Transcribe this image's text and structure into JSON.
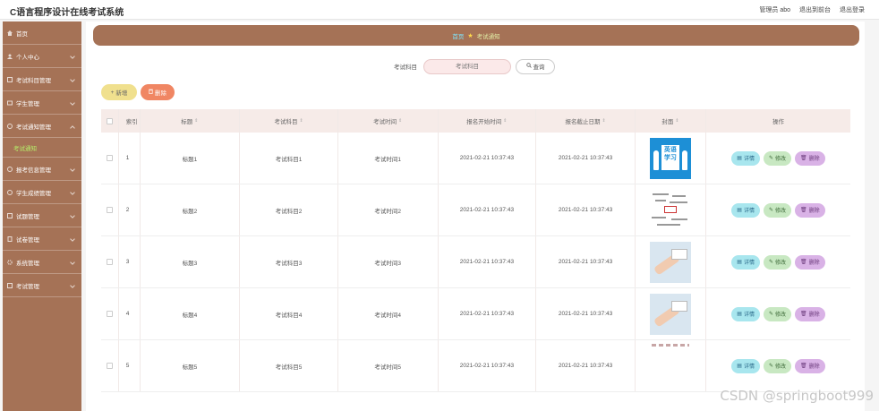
{
  "header": {
    "app_title": "C语言程序设计在线考试系统",
    "admin_label": "管理员 abo",
    "to_frontend": "退出到前台",
    "logout": "退出登录"
  },
  "sidebar": {
    "items": [
      {
        "label": "首页",
        "icon": "home-icon"
      },
      {
        "label": "个人中心",
        "icon": "user-icon"
      },
      {
        "label": "考试科目管理",
        "icon": "book-icon"
      },
      {
        "label": "学生管理",
        "icon": "student-icon"
      },
      {
        "label": "考试通知管理",
        "icon": "notice-icon"
      },
      {
        "label": "报考信息管理",
        "icon": "form-icon"
      },
      {
        "label": "学生成绩管理",
        "icon": "score-icon"
      },
      {
        "label": "试题管理",
        "icon": "question-icon"
      },
      {
        "label": "试卷管理",
        "icon": "paper-icon"
      },
      {
        "label": "系统管理",
        "icon": "gear-icon"
      },
      {
        "label": "考试管理",
        "icon": "exam-icon"
      }
    ],
    "active_sub": "考试通知"
  },
  "breadcrumb": {
    "home": "首页",
    "current": "考试通知"
  },
  "search": {
    "label": "考试科目",
    "placeholder": "考试科目",
    "button": "查询"
  },
  "actions": {
    "add": "新增",
    "delete": "删除"
  },
  "table": {
    "columns": [
      "索引",
      "标题",
      "考试科目",
      "考试时间",
      "报名开始时间",
      "报名截止日期",
      "封面",
      "操作"
    ],
    "rows": [
      {
        "index": "1",
        "title": "标题1",
        "subject": "考试科目1",
        "exam_time": "考试时间1",
        "start": "2021-02-21 10:37:43",
        "end": "2021-02-21 10:37:43",
        "cover": "english-poster-image"
      },
      {
        "index": "2",
        "title": "标题2",
        "subject": "考试科目2",
        "exam_time": "考试时间2",
        "start": "2021-02-21 10:37:43",
        "end": "2021-02-21 10:37:43",
        "cover": "word-cloud-image"
      },
      {
        "index": "3",
        "title": "标题3",
        "subject": "考试科目3",
        "exam_time": "考试时间3",
        "start": "2021-02-21 10:37:43",
        "end": "2021-02-21 10:37:43",
        "cover": "hand-card-image"
      },
      {
        "index": "4",
        "title": "标题4",
        "subject": "考试科目4",
        "exam_time": "考试时间4",
        "start": "2021-02-21 10:37:43",
        "end": "2021-02-21 10:37:43",
        "cover": "hand-card-image"
      },
      {
        "index": "5",
        "title": "标题5",
        "subject": "考试科目5",
        "exam_time": "考试时间5",
        "start": "2021-02-21 10:37:43",
        "end": "2021-02-21 10:37:43",
        "cover": "partial-image"
      }
    ],
    "ops": {
      "detail": "详情",
      "edit": "修改",
      "remove": "删除"
    }
  },
  "watermark": "CSDN @springboot999",
  "colors": {
    "accent": "#a57256",
    "add": "#f0e08e",
    "delete": "#f08663",
    "detail": "#a8e6ee",
    "edit": "#c8e8c2",
    "remove": "#d9b2e6"
  }
}
